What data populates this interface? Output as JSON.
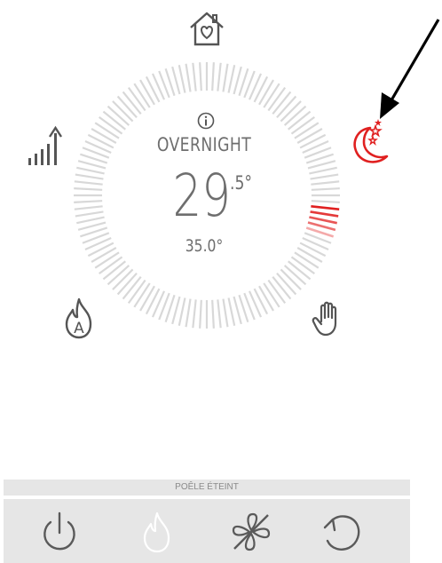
{
  "dial": {
    "mode": "OVERNIGHT",
    "temperature_whole": "29",
    "temperature_fraction": ".5°",
    "setpoint": "35.0°"
  },
  "modes": {
    "home_icon": "house-heart-icon",
    "signal_icon": "signal-strength-icon",
    "auto_flame_icon": "flame-auto-icon",
    "manual_icon": "hand-icon",
    "night_icon": "moon-stars-icon"
  },
  "status": {
    "label": "POÊLE ÉTEINT"
  },
  "toolbar": {
    "power_icon": "power-icon",
    "flame_icon": "flame-icon",
    "fan_off_icon": "fan-off-icon",
    "reset_icon": "reset-icon"
  },
  "colors": {
    "accent": "#e02020",
    "tick_gray": "#d8d8d8",
    "text_gray": "#6e6e6e",
    "bar_bg": "#e6e6e6"
  }
}
